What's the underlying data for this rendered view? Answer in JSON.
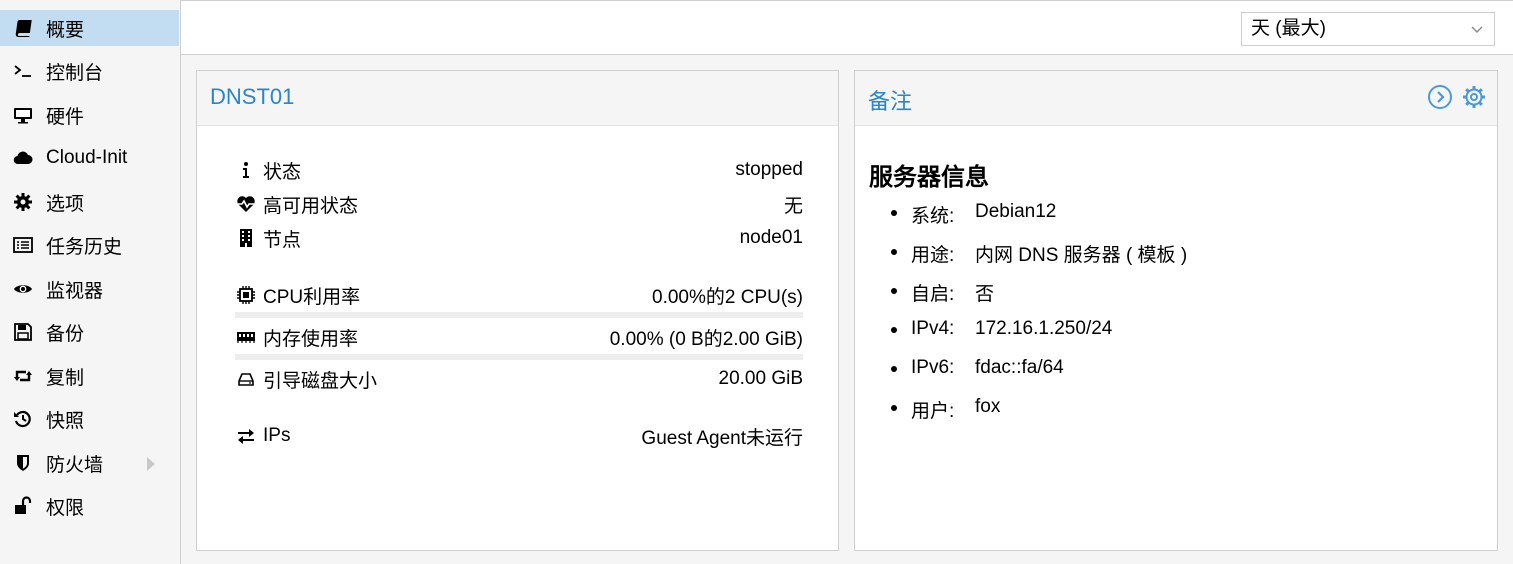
{
  "sidebar": {
    "items": [
      {
        "label": "概要",
        "icon": "book-icon",
        "active": true
      },
      {
        "label": "控制台",
        "icon": "terminal-icon"
      },
      {
        "label": "硬件",
        "icon": "monitor-icon"
      },
      {
        "label": "Cloud-Init",
        "icon": "cloud-icon"
      },
      {
        "label": "选项",
        "icon": "gear-icon"
      },
      {
        "label": "任务历史",
        "icon": "list-icon"
      },
      {
        "label": "监视器",
        "icon": "eye-icon"
      },
      {
        "label": "备份",
        "icon": "floppy-icon"
      },
      {
        "label": "复制",
        "icon": "retweet-icon"
      },
      {
        "label": "快照",
        "icon": "history-icon"
      },
      {
        "label": "防火墙",
        "icon": "shield-icon",
        "expandable": true
      },
      {
        "label": "权限",
        "icon": "unlock-icon"
      }
    ]
  },
  "toolbar": {
    "timeframe_value": "天 (最大)"
  },
  "status_panel": {
    "title": "DNST01",
    "rows": [
      {
        "label": "状态",
        "value": "stopped",
        "icon": "info-icon"
      },
      {
        "label": "高可用状态",
        "value": "无",
        "icon": "heartbeat-icon"
      },
      {
        "label": "节点",
        "value": "node01",
        "icon": "building-icon"
      },
      {
        "label": "CPU利用率",
        "value": "0.00%的2 CPU(s)",
        "icon": "cpu-icon"
      },
      {
        "label": "内存使用率",
        "value": "0.00% (0 B的2.00 GiB)",
        "icon": "memory-icon"
      },
      {
        "label": "引导磁盘大小",
        "value": "20.00 GiB",
        "icon": "hdd-icon"
      },
      {
        "label": "IPs",
        "value": "Guest Agent未运行",
        "icon": "exchange-icon"
      }
    ],
    "cpu_usage": 0,
    "mem_usage": 0
  },
  "notes_panel": {
    "title": "备注",
    "heading": "服务器信息",
    "items": [
      {
        "key": "系统:",
        "value": "Debian12"
      },
      {
        "key": "用途:",
        "value": "内网 DNS 服务器 ( 模板 )"
      },
      {
        "key": "自启:",
        "value": "否"
      },
      {
        "key": "IPv4:",
        "value": "172.16.1.250/24"
      },
      {
        "key": "IPv6:",
        "value": "fdac::fa/64"
      },
      {
        "key": "用户:",
        "value": "fox"
      }
    ]
  },
  "colors": {
    "accent": "#2a86c9",
    "active_bg": "#c2ddf2"
  }
}
